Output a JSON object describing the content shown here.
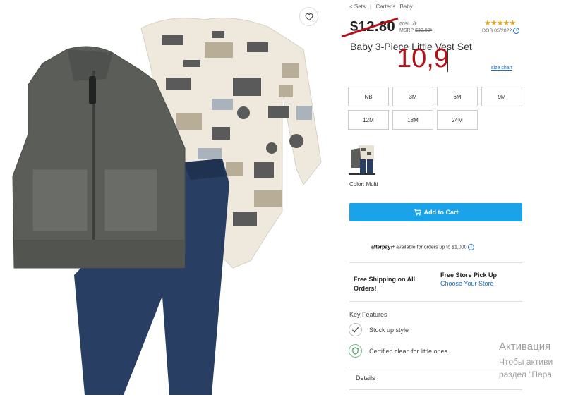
{
  "breadcrumb": {
    "items": [
      "< Sets",
      "|",
      "Carter's",
      "Baby"
    ]
  },
  "price": {
    "old": "$12.80",
    "discount": "60% off",
    "msrp_label": "MSRP",
    "msrp_value": "$32.00*"
  },
  "rating": {
    "stars": "★★★★★",
    "dob": "DOB 05/2022"
  },
  "product": {
    "title": "Baby 3-Piece Little Vest Set",
    "handwritten_price": "10,9"
  },
  "size_chart": "size chart",
  "sizes": [
    "NB",
    "3M",
    "6M",
    "9M",
    "12M",
    "18M",
    "24M"
  ],
  "color": {
    "label": "Color: Multi"
  },
  "cart": {
    "label": "Add to Cart"
  },
  "afterpay": {
    "brand": "afterpay",
    "text": "available for orders up to $1,000"
  },
  "shipping": {
    "free_ship": "Free Shipping on All Orders!",
    "pickup": "Free Store Pick Up",
    "choose_store": "Choose Your Store"
  },
  "key_features": {
    "heading": "Key Features",
    "items": [
      "Stock up style",
      "Certified clean for little ones"
    ]
  },
  "details": {
    "label": "Details"
  },
  "watermark": {
    "line1": "Активация",
    "line2": "Чтобы активи",
    "line3": "раздел \"Пара"
  },
  "colors": {
    "accent": "#1aa3e8",
    "red_ink": "#b3111a",
    "star": "#e8a317",
    "link": "#1a6fc4"
  }
}
